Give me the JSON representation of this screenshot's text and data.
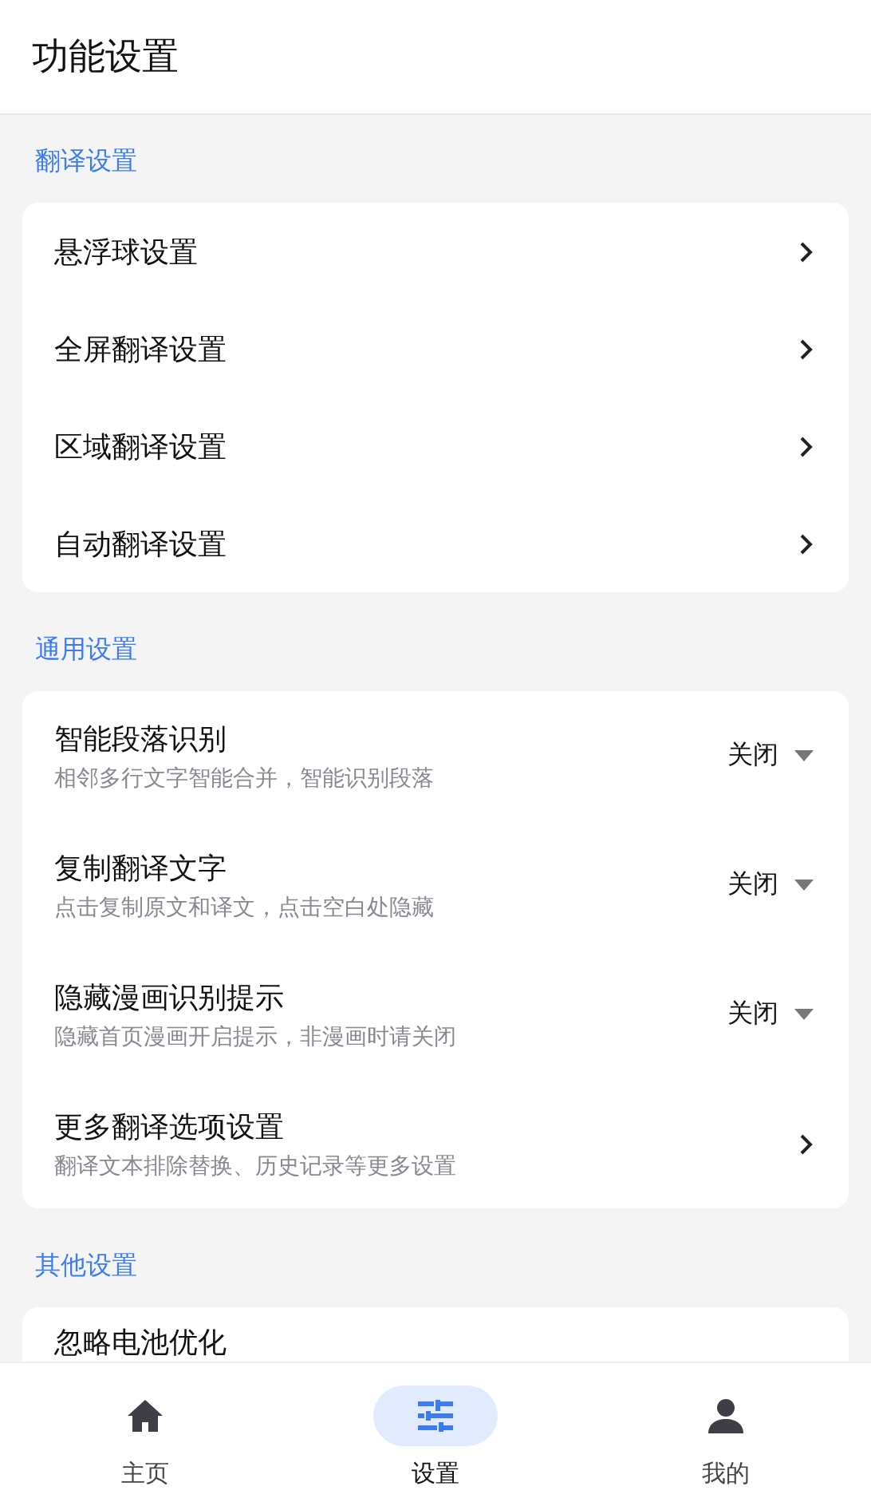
{
  "header": {
    "title": "功能设置"
  },
  "sections": [
    {
      "title": "翻译设置",
      "items": [
        {
          "kind": "link",
          "title": "悬浮球设置"
        },
        {
          "kind": "link",
          "title": "全屏翻译设置"
        },
        {
          "kind": "link",
          "title": "区域翻译设置"
        },
        {
          "kind": "link",
          "title": "自动翻译设置"
        }
      ]
    },
    {
      "title": "通用设置",
      "items": [
        {
          "kind": "select",
          "title": "智能段落识别",
          "subtitle": "相邻多行文字智能合并，智能识别段落",
          "value": "关闭"
        },
        {
          "kind": "select",
          "title": "复制翻译文字",
          "subtitle": "点击复制原文和译文，点击空白处隐藏",
          "value": "关闭"
        },
        {
          "kind": "select",
          "title": "隐藏漫画识别提示",
          "subtitle": "隐藏首页漫画开启提示，非漫画时请关闭",
          "value": "关闭"
        },
        {
          "kind": "link",
          "title": "更多翻译选项设置",
          "subtitle": "翻译文本排除替换、历史记录等更多设置"
        }
      ]
    },
    {
      "title": "其他设置",
      "items": [
        {
          "kind": "plain",
          "title": "忽略电池优化"
        }
      ]
    }
  ],
  "nav": [
    {
      "label": "主页",
      "selected": false
    },
    {
      "label": "设置",
      "selected": true
    },
    {
      "label": "我的",
      "selected": false
    }
  ]
}
